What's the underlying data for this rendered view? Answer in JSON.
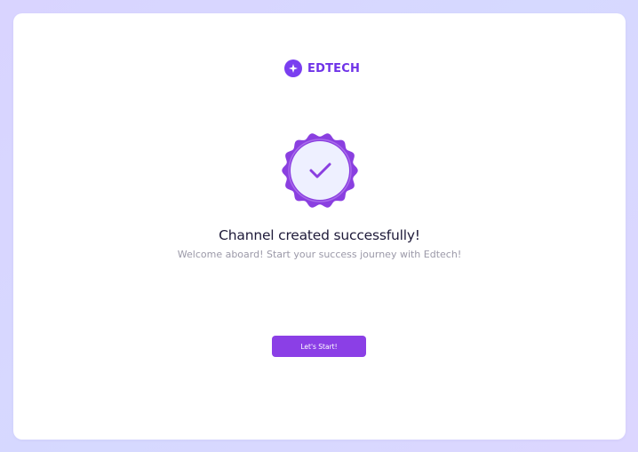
{
  "brand": {
    "name": "EDTECH",
    "logo_icon": "sparkle-icon",
    "color": "#6f33e8"
  },
  "status": {
    "icon": "checkmark-badge-icon",
    "title": "Channel created successfully!",
    "subtitle": "Welcome aboard! Start your success journey with Edtech!"
  },
  "actions": {
    "start_label": "Let's Start!"
  },
  "colors": {
    "accent": "#8b3fe6",
    "badge_outer": "#8a3fe0",
    "badge_inner": "#eef0ff",
    "title_text": "#1f1b3a",
    "subtitle_text": "#9b99a8"
  }
}
